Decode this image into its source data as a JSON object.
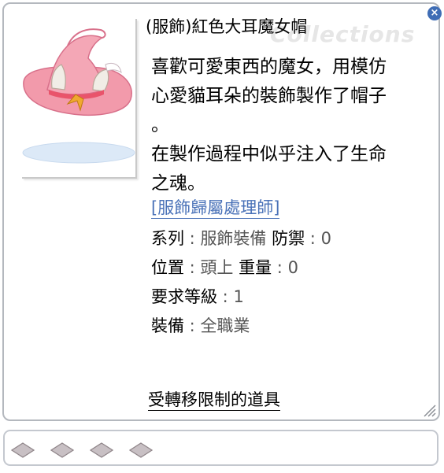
{
  "item": {
    "title": "(服飾)紅色大耳魔女帽",
    "watermark": "Collections",
    "description_lines": [
      "喜歡可愛東西的魔女，用模仿",
      "心愛貓耳朵的裝飾製作了帽子",
      "。",
      "在製作過程中似乎注入了生命",
      "之魂。"
    ],
    "owner_link": "[服飾歸屬處理師]",
    "properties": {
      "series_label": "系列",
      "series_value": "服飾裝備",
      "defense_label": "防禦",
      "defense_value": "0",
      "position_label": "位置",
      "position_value": "頭上",
      "weight_label": "重量",
      "weight_value": "0",
      "level_label": "要求等級",
      "level_value": "1",
      "equip_label": "裝備",
      "equip_value": "全職業"
    },
    "restriction": "受轉移限制的道具",
    "close_icon": "close-icon",
    "image_icon": "witch-hat-image"
  },
  "slot_bar": {
    "slot_count": 4,
    "slot_icon": "empty-card-slot-icon"
  },
  "colors": {
    "hat_pink": "#f29aab",
    "link_blue": "#4a72b8",
    "close_blue": "#3f6db5",
    "frame_gray": "#b4b8be"
  }
}
